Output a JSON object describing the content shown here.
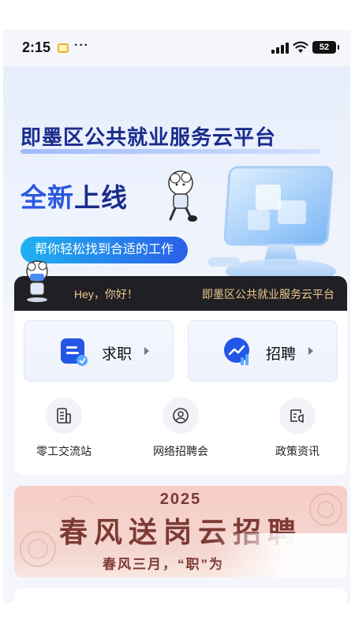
{
  "status_bar": {
    "time": "2:15",
    "more": "···",
    "battery": "52"
  },
  "hero": {
    "title": "即墨区公共就业服务云平台",
    "subtitle_part1": "全新",
    "subtitle_part2": "上线",
    "pill": "帮你轻松找到合适的工作"
  },
  "greeting": {
    "hello": "Hey，你好！",
    "platform": "即墨区公共就业服务云平台"
  },
  "main_actions": [
    {
      "label": "求职",
      "icon": "document-icon"
    },
    {
      "label": "招聘",
      "icon": "trend-chart-icon"
    }
  ],
  "quick_links": [
    {
      "label": "零工交流站",
      "icon": "building-icon"
    },
    {
      "label": "网络招聘会",
      "icon": "user-at-icon"
    },
    {
      "label": "政策资讯",
      "icon": "broadcast-icon"
    }
  ],
  "spring_banner": {
    "year": "2025",
    "title": "春风送岗云招聘",
    "subtitle": "春风三月，“职”为"
  },
  "colors": {
    "brand_blue": "#2b57e0",
    "dark_bar": "#1f1f24",
    "gold_text": "#f0c98c",
    "banner_red": "#7d3a34"
  }
}
